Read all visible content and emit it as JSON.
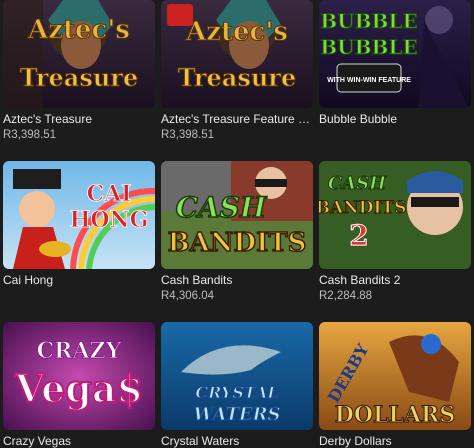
{
  "games": [
    {
      "title": "Aztec's Treasure",
      "jackpot": "R3,398.51",
      "art": "AZTEC'S TREASURE",
      "art_l1": "Aztec's",
      "art_l2": "Treasure",
      "icon": "aztec-warrior-icon"
    },
    {
      "title": "Aztec's Treasure Feature G...",
      "jackpot": "R3,398.51",
      "art": "AZTEC'S TREASURE",
      "art_l1": "Aztec's",
      "art_l2": "Treasure",
      "icon": "aztec-warrior-icon"
    },
    {
      "title": "Bubble Bubble",
      "jackpot": "",
      "art_l1": "BUBBLE",
      "art_l2": "BUBBLE",
      "art_badge": "WITH WIN-WIN FEATURE",
      "icon": "witch-icon"
    },
    {
      "title": "Cai Hong",
      "jackpot": "",
      "art_l1": "CAI",
      "art_l2": "HONG",
      "icon": "fortune-god-icon"
    },
    {
      "title": "Cash Bandits",
      "jackpot": "R4,306.04",
      "art_l1": "CASH",
      "art_l2": "BANDITS",
      "icon": "bandit-icon"
    },
    {
      "title": "Cash Bandits 2",
      "jackpot": "R2,284.88",
      "art_l1": "CASH",
      "art_l2": "BANDITS",
      "art_num": "2",
      "icon": "bandit-icon"
    },
    {
      "title": "Crazy Vegas",
      "jackpot": "",
      "art_l1": "CRAZY",
      "art_l2": "Vega$",
      "icon": "dice-icon"
    },
    {
      "title": "Crystal Waters",
      "jackpot": "",
      "art_l1": "CRYSTAL",
      "art_l2": "WATERS",
      "icon": "dolphin-icon"
    },
    {
      "title": "Derby Dollars",
      "jackpot": "",
      "art_l1": "DERBY",
      "art_l2": "DOLLARS",
      "icon": "horse-jockey-icon"
    }
  ],
  "colors": {
    "background": "#1c1c1c",
    "title": "#eaeaea",
    "jackpot": "#bdbdbd"
  }
}
